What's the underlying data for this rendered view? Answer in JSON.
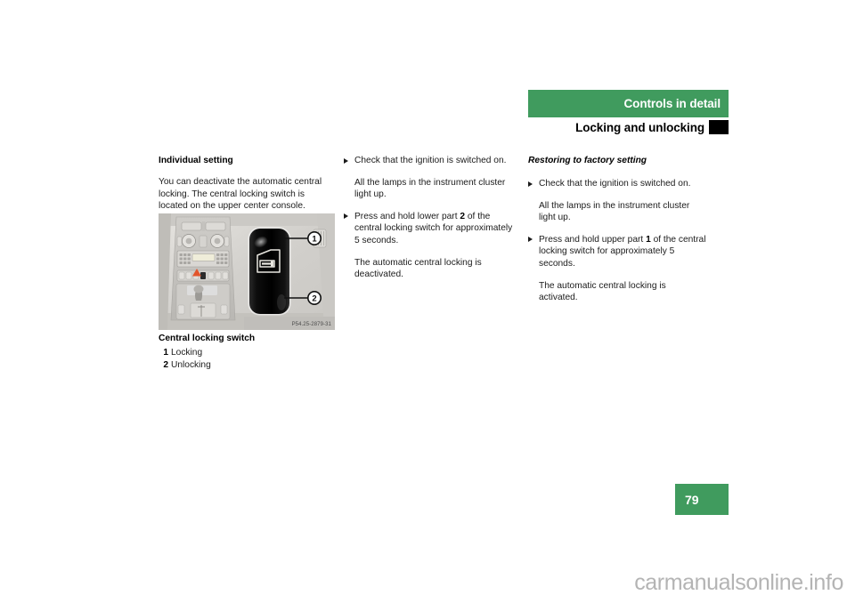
{
  "header": {
    "chapter_title": "Controls in detail",
    "section_title": "Locking and unlocking",
    "bar_color": "#409b5e",
    "tab_color": "#000000"
  },
  "column_left": {
    "heading": "Individual setting",
    "paragraph": "You can deactivate the automatic central locking. The central locking switch is located on the upper center console.",
    "figure": {
      "image_code": "P54.25-2879-31",
      "caption": "Central locking switch",
      "callouts": [
        {
          "number": "1",
          "label": "Locking"
        },
        {
          "number": "2",
          "label": "Unlocking"
        }
      ]
    }
  },
  "column_middle": {
    "steps": [
      {
        "bullet": "Check that the ignition is switched on.",
        "result": "All the lamps in the instrument cluster light up."
      },
      {
        "bullet_before": "Press and hold lower part ",
        "bullet_bold": "2",
        "bullet_after": " of the central locking switch for approximately 5 seconds.",
        "result": "The automatic central locking is deactivated."
      }
    ]
  },
  "column_right": {
    "heading": "Restoring to factory setting",
    "steps": [
      {
        "bullet": "Check that the ignition is switched on.",
        "result": "All the lamps in the instrument cluster light up."
      },
      {
        "bullet_before": "Press and hold upper part ",
        "bullet_bold": "1",
        "bullet_after": " of the central locking switch for approximately 5 seconds.",
        "result": "The automatic central locking is activated."
      }
    ]
  },
  "footer": {
    "page_number": "79",
    "watermark": "carmanualsonline.info"
  }
}
